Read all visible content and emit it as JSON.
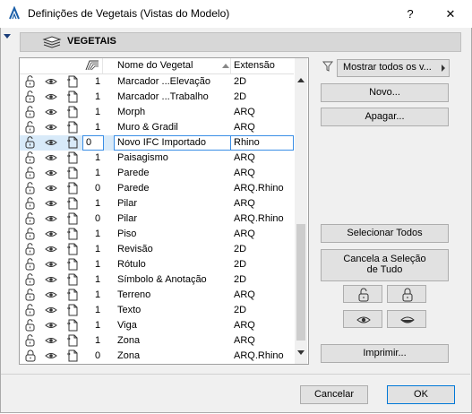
{
  "window": {
    "title": "Definições de Vegetais (Vistas do Modelo)",
    "help_label": "?",
    "close_label": "✕"
  },
  "section": {
    "label": "VEGETAIS",
    "icon": "layers-icon"
  },
  "table": {
    "headers": {
      "name": "Nome do Vegetal",
      "ext": "Extensão"
    },
    "rows": [
      {
        "lock": "unlocked",
        "count": "1",
        "name": "Marcador ...Elevação",
        "ext": "2D"
      },
      {
        "lock": "unlocked",
        "count": "1",
        "name": "Marcador ...Trabalho",
        "ext": "2D"
      },
      {
        "lock": "unlocked",
        "count": "1",
        "name": "Morph",
        "ext": "ARQ"
      },
      {
        "lock": "unlocked",
        "count": "1",
        "name": "Muro & Gradil",
        "ext": "ARQ"
      },
      {
        "lock": "unlocked",
        "count": "0",
        "name": "Novo IFC Importado",
        "ext": "Rhino",
        "selected": true
      },
      {
        "lock": "unlocked",
        "count": "1",
        "name": "Paisagismo",
        "ext": "ARQ"
      },
      {
        "lock": "unlocked",
        "count": "1",
        "name": "Parede",
        "ext": "ARQ"
      },
      {
        "lock": "unlocked",
        "count": "0",
        "name": "Parede",
        "ext": "ARQ.Rhino"
      },
      {
        "lock": "unlocked",
        "count": "1",
        "name": "Pilar",
        "ext": "ARQ"
      },
      {
        "lock": "unlocked",
        "count": "0",
        "name": "Pilar",
        "ext": "ARQ.Rhino"
      },
      {
        "lock": "unlocked",
        "count": "1",
        "name": "Piso",
        "ext": "ARQ"
      },
      {
        "lock": "unlocked",
        "count": "1",
        "name": "Revisão",
        "ext": "2D"
      },
      {
        "lock": "unlocked",
        "count": "1",
        "name": "Rótulo",
        "ext": "2D"
      },
      {
        "lock": "unlocked",
        "count": "1",
        "name": "Símbolo & Anotação",
        "ext": "2D"
      },
      {
        "lock": "unlocked",
        "count": "1",
        "name": "Terreno",
        "ext": "ARQ"
      },
      {
        "lock": "unlocked",
        "count": "1",
        "name": "Texto",
        "ext": "2D"
      },
      {
        "lock": "unlocked",
        "count": "1",
        "name": "Viga",
        "ext": "ARQ"
      },
      {
        "lock": "unlocked",
        "count": "1",
        "name": "Zona",
        "ext": "ARQ"
      },
      {
        "lock": "locked",
        "count": "0",
        "name": "Zona",
        "ext": "ARQ.Rhino"
      }
    ]
  },
  "filter": {
    "selected": "Mostrar todos os v..."
  },
  "buttons": {
    "new": "Novo...",
    "delete": "Apagar...",
    "select_all": "Selecionar Todos",
    "deselect_line1": "Cancela a Seleção",
    "deselect_line2": "de Tudo",
    "print": "Imprimir...",
    "cancel": "Cancelar",
    "ok": "OK"
  },
  "colors": {
    "selection": "#d8eaf9",
    "focus_border": "#3a8ee6",
    "ok_border": "#0078d7"
  }
}
